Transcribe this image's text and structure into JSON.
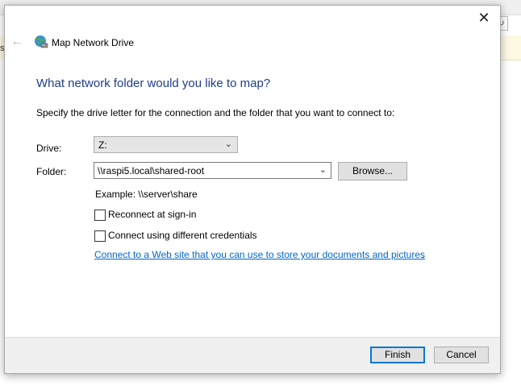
{
  "window": {
    "title": "Map Network Drive",
    "close_glyph": "✕",
    "back_glyph": "←",
    "background_partial_text": "s"
  },
  "main": {
    "heading": "What network folder would you like to map?",
    "instruction": "Specify the drive letter for the connection and the folder that you want to connect to:",
    "drive_label": "Drive:",
    "drive_value": "Z:",
    "folder_label": "Folder:",
    "folder_value": "\\\\raspi5.local\\shared-root",
    "browse_label": "Browse...",
    "example_text": "Example: \\\\server\\share",
    "reconnect_label": "Reconnect at sign-in",
    "reconnect_checked": false,
    "credentials_label": "Connect using different credentials",
    "credentials_checked": false,
    "web_link": "Connect to a Web site that you can use to store your documents and pictures",
    "web_link_suffix": "."
  },
  "footer": {
    "finish_label": "Finish",
    "cancel_label": "Cancel"
  },
  "icons": {
    "title_icon": "network-drive-icon",
    "back": "back-arrow-icon",
    "close": "close-icon",
    "dropdown": "chevron-down-icon"
  },
  "colors": {
    "heading": "#1e3d8a",
    "link": "#0066cc",
    "accent": "#0078d7"
  }
}
